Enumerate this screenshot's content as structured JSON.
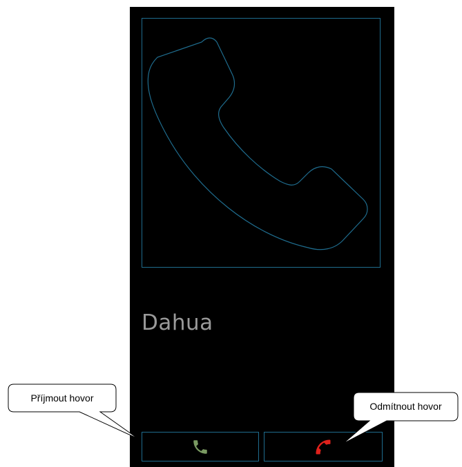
{
  "screen": {
    "background": "#000000",
    "accent": "#1f6d8f"
  },
  "caller": {
    "name": "Dahua",
    "avatar_icon": "phone-handset-icon"
  },
  "actions": {
    "accept": {
      "icon": "phone-icon",
      "color": "#7a9a62"
    },
    "decline": {
      "icon": "phone-hangup-icon",
      "color": "#e0211b"
    }
  },
  "annotations": {
    "accept_callout": "Příjmout hovor",
    "decline_callout": "Odmítnout hovor"
  }
}
